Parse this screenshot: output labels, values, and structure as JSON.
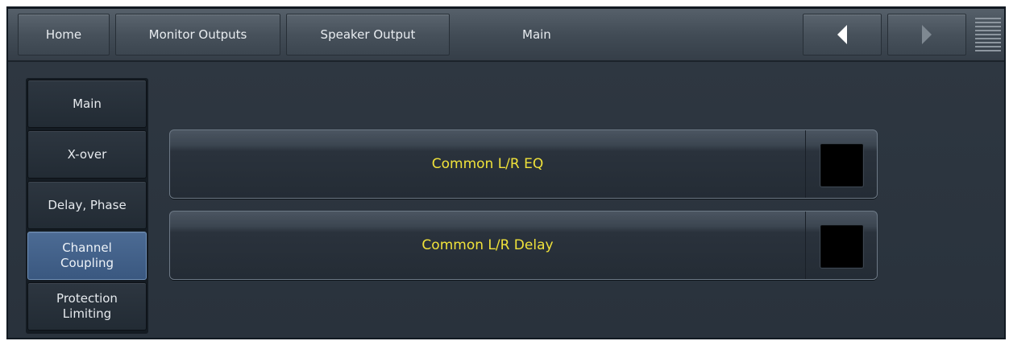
{
  "topbar": {
    "buttons": [
      "Home",
      "Monitor Outputs",
      "Speaker Output"
    ],
    "current_page": "Main",
    "back_icon": "triangle-left-icon",
    "forward_icon": "triangle-right-icon",
    "menu_icon": "menu-lines-icon"
  },
  "sidebar": {
    "items": [
      "Main",
      "X-over",
      "Delay, Phase",
      "Channel\nCoupling",
      "Protection\nLimiting"
    ],
    "active_index": 3
  },
  "options": [
    {
      "label": "Common L/R EQ",
      "checked": false
    },
    {
      "label": "Common L/R Delay",
      "checked": false
    }
  ],
  "colors": {
    "accent_text": "#f0e23a",
    "active_tab": "#45638b",
    "toggle_off": "#000000"
  }
}
